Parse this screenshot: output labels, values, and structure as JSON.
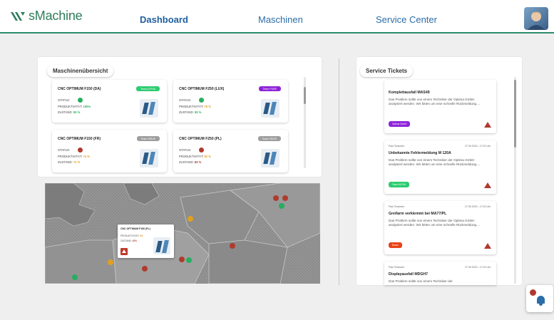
{
  "app": {
    "logo_text": "sMachine",
    "brand_color": "#2e8c6e",
    "link_color": "#2b6da8"
  },
  "nav": {
    "items": [
      {
        "label": "Dashboard",
        "active": true
      },
      {
        "label": "Maschinen",
        "active": false
      },
      {
        "label": "Service Center",
        "active": false
      }
    ]
  },
  "overview": {
    "title": "Maschinenübersicht",
    "machines": [
      {
        "name": "CNC OPTIMUM F150 (DA)",
        "badge": "Team ALPHA",
        "badge_color": "#2ecc71",
        "status_label": "STATUS:",
        "status_color": "#27ae60",
        "productivity_label": "PRODUKTIVITÄT:",
        "productivity": "100%",
        "productivity_color": "#27ae60",
        "state_label": "ZUSTAND:",
        "state": "93 %",
        "state_color": "#27ae60"
      },
      {
        "name": "CNC OPTIMUM F250 (LUX)",
        "badge": "Team PURE",
        "badge_color": "#8e24d9",
        "status_label": "STATUS:",
        "status_color": "#27ae60",
        "productivity_label": "PRODUKTIVITÄT:",
        "productivity": "78 %",
        "productivity_color": "#e0a020",
        "state_label": "ZUSTAND:",
        "state": "93 %",
        "state_color": "#27ae60"
      },
      {
        "name": "CNC OPTIMUM F150 (FR)",
        "badge": "Team DRIVE",
        "badge_color": "#9e9e9e",
        "status_label": "STATUS:",
        "status_color": "#b03a2e",
        "productivity_label": "PRODUKTIVITÄT:",
        "productivity": "74 %",
        "productivity_color": "#e0a020",
        "state_label": "ZUSTAND:",
        "state": "72 %",
        "state_color": "#e0a020"
      },
      {
        "name": "CNC OPTIMUM F250 (PL)",
        "badge": "Team DRIVE",
        "badge_color": "#9e9e9e",
        "status_label": "STATUS:",
        "status_color": "#b03a2e",
        "productivity_label": "PRODUKTIVITÄT:",
        "productivity": "82 %",
        "productivity_color": "#e0a020",
        "state_label": "ZUSTAND:",
        "state": "83 %",
        "state_color": "#b03a2e"
      }
    ]
  },
  "map_popup": {
    "title": "CNC OPTIMUM F150 (PL)",
    "productivity_label": "PRODUKTIVITÄT:",
    "productivity": "6%",
    "state_label": "ZUSTAND:",
    "state": "10%"
  },
  "tickets": {
    "title": "Service Tickets",
    "items": [
      {
        "author": "",
        "date": "",
        "title": "Komplettausfall MAS49",
        "desc": "Das Problem sollte von einem Techniker der Optima GmbH analysiert werden. Wir bitten um eine schnelle Rückmeldung....",
        "badge": "Optima GmbH",
        "badge_color": "#8e24d9"
      },
      {
        "author": "Paul Teutonen",
        "date": "27.09.2023 - 17:20 Uhr",
        "title": "Unbekannte Fehlermeldung M 120A",
        "desc": "Das Problem sollte von einem Techniker der Optima GmbH analysiert werden. Wir bitten um eine schnelle Rückmeldung....",
        "badge": "Team ALPHA",
        "badge_color": "#2ecc71"
      },
      {
        "author": "Paul Teutonen",
        "date": "27.09.2023 - 17:20 Uhr",
        "title": "Greifarm verklemmt bei MA77/PL",
        "desc": "Das Problem sollte von einem Techniker der Optima GmbH analysiert werden. Wir bitten um eine schnelle Rückmeldung....",
        "badge": "Bosch",
        "badge_color": "#e8431a"
      },
      {
        "author": "Paul Teutonen",
        "date": "27.09.2023 - 17:20 Uhr",
        "title": "Displayausfall MDGH7",
        "desc": "Das Problem sollte von einem Techniker der",
        "badge": "",
        "badge_color": ""
      }
    ]
  }
}
